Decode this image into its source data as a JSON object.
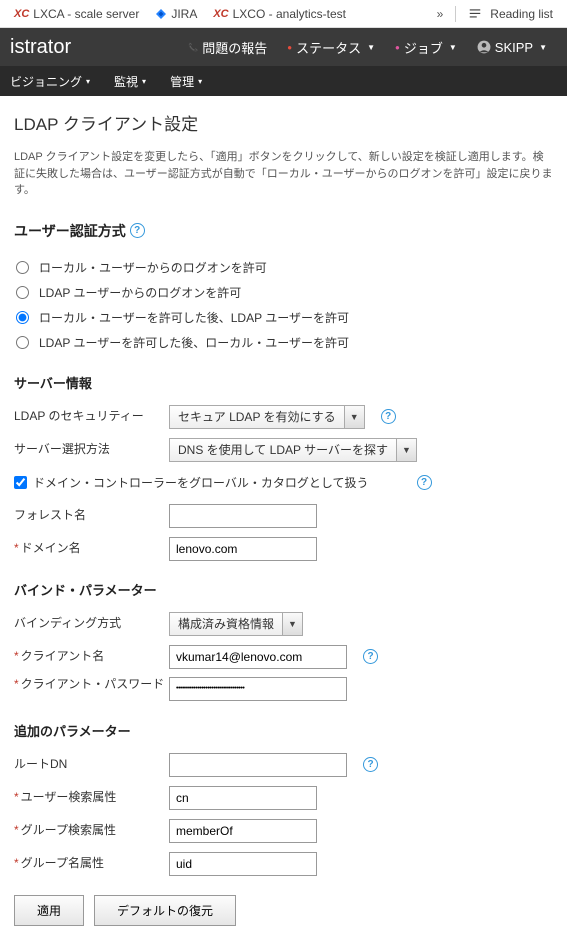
{
  "browser": {
    "tabs": [
      {
        "icon": "xc",
        "label": "LXCA - scale server"
      },
      {
        "icon": "jira",
        "label": "JIRA"
      },
      {
        "icon": "xc",
        "label": "LXCO - analytics-test"
      }
    ],
    "reading_list": "Reading list"
  },
  "header": {
    "app_title": "istrator",
    "report": "問題の報告",
    "status": "ステータス",
    "jobs": "ジョブ",
    "user": "SKIPP"
  },
  "nav": {
    "provisioning": "ビジョニング",
    "monitor": "監視",
    "admin": "管理"
  },
  "page": {
    "title": "LDAP クライアント設定",
    "description": "LDAP クライアント設定を変更したら、「適用」ボタンをクリックして、新しい設定を検証し適用します。検証に失敗した場合は、ユーザー認証方式が自動で「ローカル・ユーザーからのログオンを許可」設定に戻ります。"
  },
  "auth": {
    "title": "ユーザー認証方式",
    "options": {
      "local": "ローカル・ユーザーからのログオンを許可",
      "ldap": "LDAP ユーザーからのログオンを許可",
      "local_then_ldap": "ローカル・ユーザーを許可した後、LDAP ユーザーを許可",
      "ldap_then_local": "LDAP ユーザーを許可した後、ローカル・ユーザーを許可"
    }
  },
  "server": {
    "title": "サーバー情報",
    "security_label": "LDAP のセキュリティー",
    "security_value": "セキュア LDAP を有効にする",
    "method_label": "サーバー選択方法",
    "method_value": "DNS を使用して LDAP サーバーを探す",
    "gc_label": "ドメイン・コントローラーをグローバル・カタログとして扱う",
    "forest_label": "フォレスト名",
    "forest_value": "",
    "domain_label": "ドメイン名",
    "domain_value": "lenovo.com"
  },
  "bind": {
    "title": "バインド・パラメーター",
    "method_label": "バインディング方式",
    "method_value": "構成済み資格情報",
    "client_label": "クライアント名",
    "client_value": "vkumar14@lenovo.com",
    "password_label": "クライアント・パスワード",
    "password_value": "•••••••••••••••••••••••••••••••••••"
  },
  "additional": {
    "title": "追加のパラメーター",
    "rootdn_label": "ルートDN",
    "rootdn_value": "",
    "user_search_label": "ユーザー検索属性",
    "user_search_value": "cn",
    "group_search_label": "グループ検索属性",
    "group_search_value": "memberOf",
    "group_name_label": "グループ名属性",
    "group_name_value": "uid"
  },
  "buttons": {
    "apply": "適用",
    "restore": "デフォルトの復元"
  }
}
